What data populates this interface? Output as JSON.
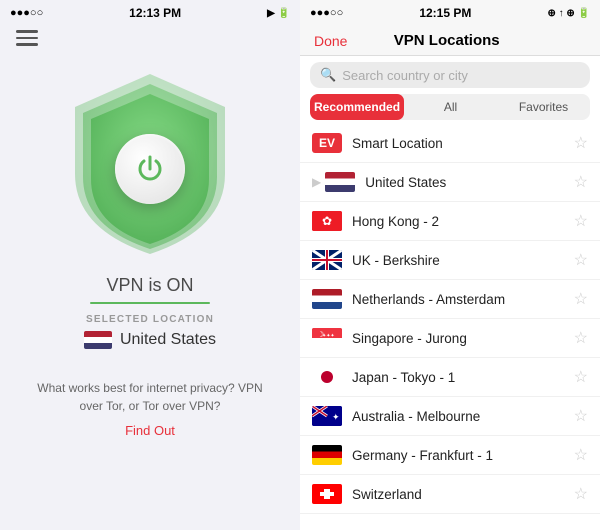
{
  "left": {
    "status_bar": {
      "dots": "●●●○○",
      "time": "12:13 PM",
      "icons": "▶ 🔋"
    },
    "vpn_status": "VPN is ON",
    "selected_location_label": "SELECTED LOCATION",
    "selected_location": "United States",
    "info_text": "What works best for internet privacy? VPN over Tor, or Tor over VPN?",
    "find_out": "Find Out"
  },
  "right": {
    "status_bar": {
      "dots": "●●●○○",
      "time": "12:15 PM",
      "icons": "🔋"
    },
    "done_label": "Done",
    "title": "VPN Locations",
    "search_placeholder": "Search country or city",
    "tabs": [
      {
        "label": "Recommended",
        "active": true
      },
      {
        "label": "All",
        "active": false
      },
      {
        "label": "Favorites",
        "active": false
      }
    ],
    "locations": [
      {
        "id": "smart",
        "name": "Smart Location",
        "type": "smart"
      },
      {
        "id": "us",
        "name": "United States",
        "type": "flag",
        "flag": "us",
        "chevron": true
      },
      {
        "id": "hk",
        "name": "Hong Kong - 2",
        "type": "flag",
        "flag": "hk"
      },
      {
        "id": "uk",
        "name": "UK - Berkshire",
        "type": "flag",
        "flag": "uk"
      },
      {
        "id": "nl",
        "name": "Netherlands - Amsterdam",
        "type": "flag",
        "flag": "nl"
      },
      {
        "id": "sg",
        "name": "Singapore - Jurong",
        "type": "flag",
        "flag": "sg"
      },
      {
        "id": "jp",
        "name": "Japan - Tokyo - 1",
        "type": "flag",
        "flag": "jp"
      },
      {
        "id": "au",
        "name": "Australia - Melbourne",
        "type": "flag",
        "flag": "au"
      },
      {
        "id": "de",
        "name": "Germany - Frankfurt - 1",
        "type": "flag",
        "flag": "de"
      },
      {
        "id": "ch",
        "name": "Switzerland",
        "type": "flag",
        "flag": "ch"
      }
    ]
  }
}
